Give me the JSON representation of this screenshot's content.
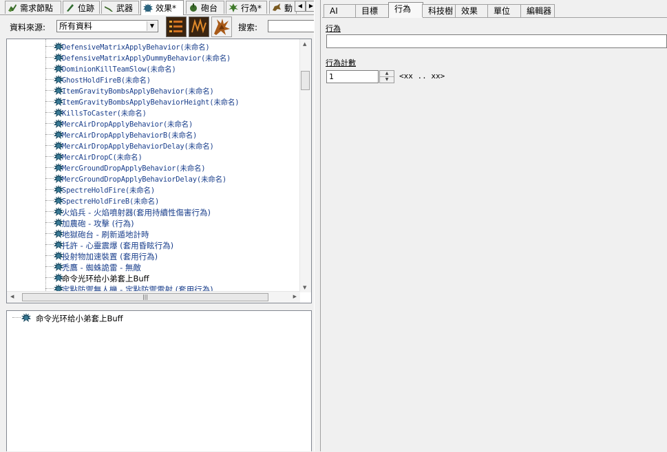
{
  "left_tabs": [
    {
      "label": "需求節點",
      "icon": "requirement-icon"
    },
    {
      "label": "位跡",
      "icon": "footprint-icon"
    },
    {
      "label": "武器",
      "icon": "weapon-icon"
    },
    {
      "label": "效果*",
      "icon": "effect-icon"
    },
    {
      "label": "砲台",
      "icon": "turret-icon"
    },
    {
      "label": "行為*",
      "icon": "behavior-icon"
    },
    {
      "label": "動",
      "icon": "actor-icon"
    }
  ],
  "toolbar": {
    "source_label": "資料來源:",
    "source_value": "所有資料",
    "search_label": "搜索:",
    "search_value": ""
  },
  "tree_items": [
    {
      "text": "DefensiveMatrixApplyBehavior(未命名)",
      "style": "mono"
    },
    {
      "text": "DefensiveMatrixApplyDummyBehavior(未命名)",
      "style": "mono"
    },
    {
      "text": "DominionKillTeamSlow(未命名)",
      "style": "mono"
    },
    {
      "text": "GhostHoldFireB(未命名)",
      "style": "mono"
    },
    {
      "text": "ItemGravityBombsApplyBehavior(未命名)",
      "style": "mono"
    },
    {
      "text": "ItemGravityBombsApplyBehaviorHeight(未命名)",
      "style": "mono"
    },
    {
      "text": "KillsToCaster(未命名)",
      "style": "mono"
    },
    {
      "text": "MercAirDropApplyBehavior(未命名)",
      "style": "mono"
    },
    {
      "text": "MercAirDropApplyBehaviorB(未命名)",
      "style": "mono"
    },
    {
      "text": "MercAirDropApplyBehaviorDelay(未命名)",
      "style": "mono"
    },
    {
      "text": "MercAirDropC(未命名)",
      "style": "mono"
    },
    {
      "text": "MercGroundDropApplyBehavior(未命名)",
      "style": "mono"
    },
    {
      "text": "MercGroundDropApplyBehaviorDelay(未命名)",
      "style": "mono"
    },
    {
      "text": "SpectreHoldFire(未命名)",
      "style": "mono"
    },
    {
      "text": "SpectreHoldFireB(未命名)",
      "style": "mono"
    },
    {
      "text": "火焰兵 - 火焰噴射器(套用持續性傷害行為)",
      "style": "cjk"
    },
    {
      "text": "加農砲 - 攻擊 (行為)",
      "style": "cjk"
    },
    {
      "text": "地獄砲台 - 刷新遁地計時",
      "style": "cjk"
    },
    {
      "text": "托許 - 心靈震爆 (套用昏眩行為)",
      "style": "cjk"
    },
    {
      "text": "投射物加速裝置 (套用行為)",
      "style": "cjk"
    },
    {
      "text": "禿鷹 - 蜘蛛詭雷 - 無敵",
      "style": "cjk"
    },
    {
      "text": "命令光环给小弟套上Buff",
      "style": "black"
    },
    {
      "text": "定點防禦無人機 - 定點防禦雷射 (套用行為)",
      "style": "cjk"
    }
  ],
  "bottom_tree": {
    "item": "命令光环给小弟套上Buff"
  },
  "right_tabs": [
    "AI",
    "目標",
    "行為",
    "科技樹",
    "效果",
    "單位",
    "編輯器"
  ],
  "right_active_tab": "行為",
  "fields": {
    "behavior_label": "行為",
    "behavior_value": "",
    "count_label": "行為計數",
    "count_value": "1",
    "count_range": "<xx .. xx>"
  },
  "colors": {
    "tree_text": "#1a3f8c",
    "icon": "#1f4f66"
  }
}
